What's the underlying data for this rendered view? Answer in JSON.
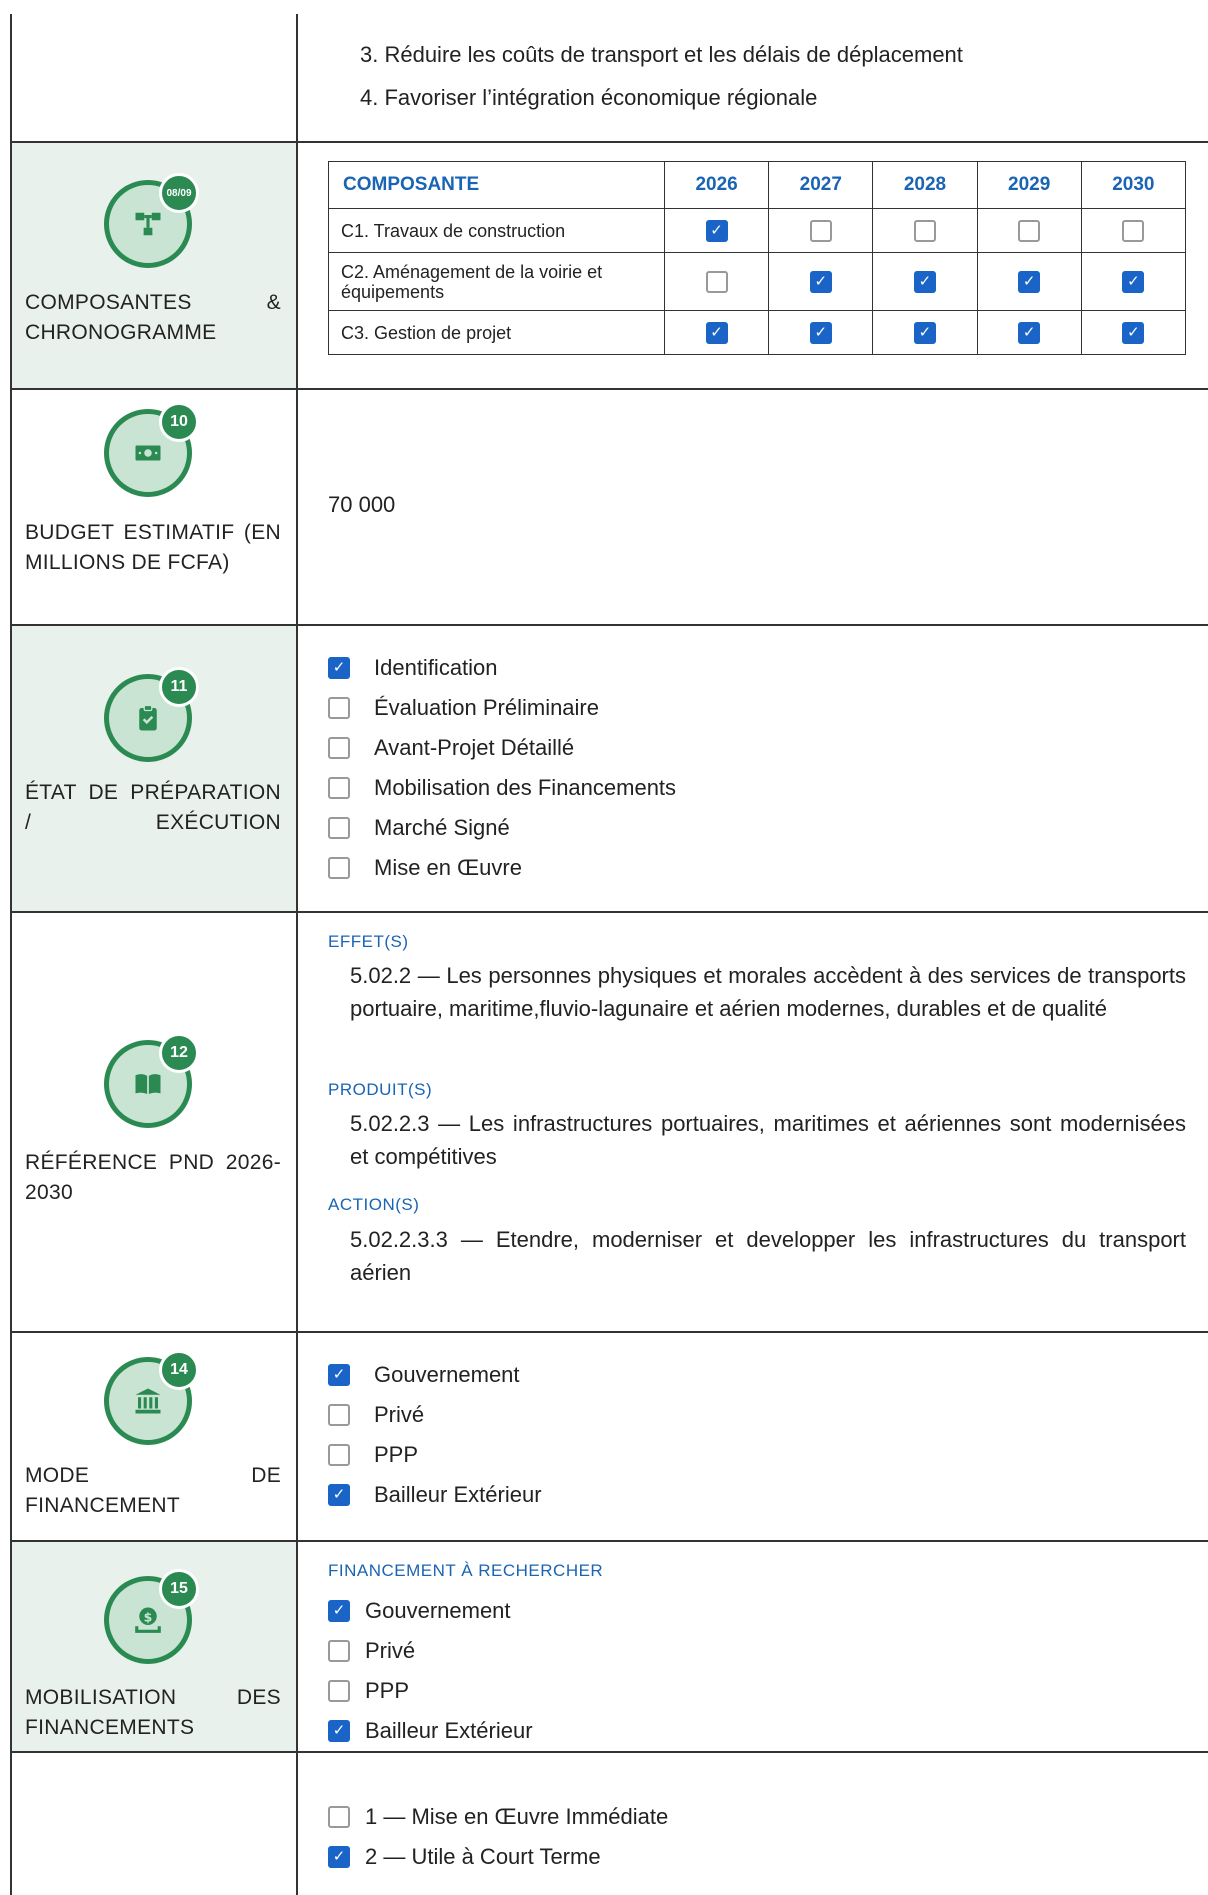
{
  "objectives": [
    "3. Réduire les coûts de transport et les délais de déplacement",
    "4. Favoriser l’intégration économique régionale"
  ],
  "sections": {
    "composantes": {
      "badge": "08/09",
      "label": "COMPOSANTES & CHRONOGRAMME",
      "icon": "diagram-icon"
    },
    "budget": {
      "badge": "10",
      "label": "BUDGET ESTIMATIF (EN MILLIONS DE FCFA)",
      "value": "70 000",
      "icon": "money-icon"
    },
    "etat": {
      "badge": "11",
      "label": "ÉTAT DE PRÉPARATION / EXÉCUTION",
      "icon": "clipboard-check-icon"
    },
    "reference": {
      "badge": "12",
      "label": "RÉFÉRENCE PND 2026-2030",
      "icon": "book-icon"
    },
    "mode": {
      "badge": "14",
      "label": "MODE DE FINANCEMENT",
      "icon": "bank-icon"
    },
    "mobilisation": {
      "badge": "15",
      "label": "MOBILISATION DES FINANCEMENTS",
      "icon": "money-hand-icon"
    }
  },
  "chronogramme": {
    "header": [
      "COMPOSANTE",
      "2026",
      "2027",
      "2028",
      "2029",
      "2030"
    ],
    "rows": [
      {
        "name": "C1. Travaux de construction",
        "checks": [
          true,
          false,
          false,
          false,
          false
        ]
      },
      {
        "name": "C2. Aménagement de la voirie et équipements",
        "checks": [
          false,
          true,
          true,
          true,
          true
        ]
      },
      {
        "name": "C3. Gestion de projet",
        "checks": [
          true,
          true,
          true,
          true,
          true
        ]
      }
    ]
  },
  "etat_items": [
    {
      "label": "Identification",
      "checked": true
    },
    {
      "label": "Évaluation Préliminaire",
      "checked": false
    },
    {
      "label": "Avant-Projet Détaillé",
      "checked": false
    },
    {
      "label": "Mobilisation des Financements",
      "checked": false
    },
    {
      "label": "Marché Signé",
      "checked": false
    },
    {
      "label": "Mise en Œuvre",
      "checked": false
    }
  ],
  "reference": {
    "effets_head": "EFFET(S)",
    "effets_text": "5.02.2 — Les personnes physiques et morales accèdent à des services de transports portuaire, maritime,fluvio-lagunaire et aérien modernes, durables et de qualité",
    "produits_head": "PRODUIT(S)",
    "produits_text": "5.02.2.3 — Les infrastructures portuaires, maritimes et aériennes sont modernisées et compétitives",
    "actions_head": "ACTION(S)",
    "actions_text": "5.02.2.3.3 — Etendre, moderniser et developper les infrastructures du transport aérien"
  },
  "mode_items": [
    {
      "label": "Gouvernement",
      "checked": true
    },
    {
      "label": "Privé",
      "checked": false
    },
    {
      "label": "PPP",
      "checked": false
    },
    {
      "label": "Bailleur Extérieur",
      "checked": true
    }
  ],
  "mobilisation": {
    "head": "FINANCEMENT À RECHERCHER",
    "items": [
      {
        "label": "Gouvernement",
        "checked": true
      },
      {
        "label": "Privé",
        "checked": false
      },
      {
        "label": "PPP",
        "checked": false
      },
      {
        "label": "Bailleur Extérieur",
        "checked": true
      }
    ]
  },
  "priorite_items": [
    {
      "label": "1 — Mise en Œuvre Immédiate",
      "checked": false
    },
    {
      "label": "2 — Utile à Court Terme",
      "checked": true
    }
  ],
  "colors": {
    "green": "#2a8a52",
    "light_green": "#c9e4d3",
    "blue": "#1a64c8",
    "left_bg": "#e9f1ec"
  }
}
